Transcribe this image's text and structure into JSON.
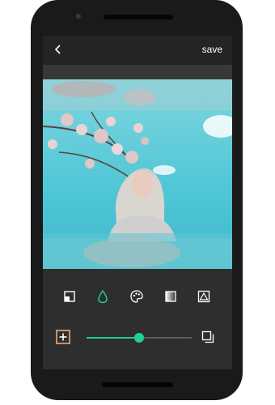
{
  "header": {
    "back_icon": "chevron-left-icon",
    "save_label": "save"
  },
  "toolbar": {
    "tools": [
      {
        "name": "crop-icon",
        "active": false
      },
      {
        "name": "droplet-icon",
        "active": true
      },
      {
        "name": "palette-icon",
        "active": false
      },
      {
        "name": "gradient-icon",
        "active": false
      },
      {
        "name": "triangle-icon",
        "active": false
      }
    ]
  },
  "adjust": {
    "slider_value": 0.5,
    "preview_icon": "add-photo-icon",
    "compare_icon": "layers-icon"
  },
  "colors": {
    "accent": "#1fd08f",
    "screen": "#2e2e2e",
    "sky": "#4ec6d6"
  }
}
